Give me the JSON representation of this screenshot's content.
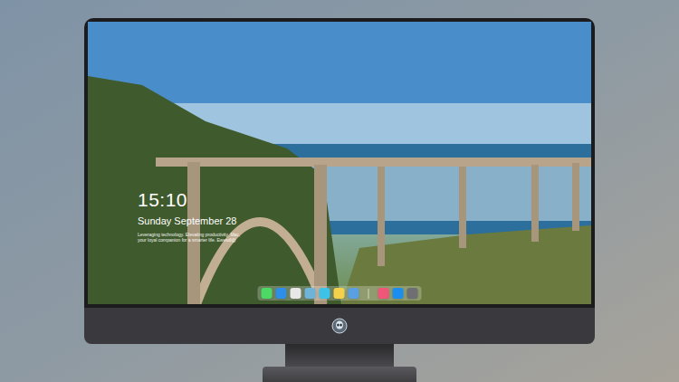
{
  "desktop": {
    "clock": {
      "time": "15:10",
      "date": "Sunday September 28",
      "tagline": "Leveraging technology. Elevating productivity. Mac, your loyal companion for a smarter life. Ewesdl@"
    },
    "dock": {
      "pinned": [
        {
          "color": "#4cd964"
        },
        {
          "color": "#2f8ee8"
        },
        {
          "color": "#e8e8e8"
        },
        {
          "color": "#6fb3d9"
        },
        {
          "color": "#3ec3e8"
        },
        {
          "color": "#f5d04a"
        },
        {
          "color": "#5aa0e0"
        }
      ],
      "extra": [
        {
          "color": "#f0567a"
        },
        {
          "color": "#1c8ef0"
        },
        {
          "color": "#6e6e73"
        }
      ]
    }
  }
}
